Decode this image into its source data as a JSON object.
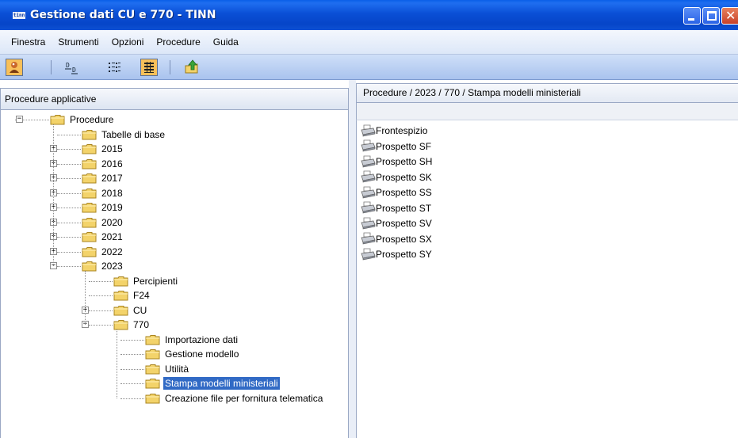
{
  "window": {
    "title": "Gestione dati CU e 770 - TINN",
    "logo_text": "tinn",
    "close_glyph": "✕"
  },
  "menu": [
    "Finestra",
    "Strumenti",
    "Opzioni",
    "Procedure",
    "Guida"
  ],
  "toolbar": {
    "buttons": [
      "user-icon",
      "sort-icon",
      "list-view-icon",
      "details-view-icon",
      "export-icon"
    ]
  },
  "left_panel": {
    "title": "Procedure applicative",
    "tree": {
      "root": "Procedure",
      "tabelle": "Tabelle di base",
      "years": [
        "2015",
        "2016",
        "2017",
        "2018",
        "2019",
        "2020",
        "2021",
        "2022"
      ],
      "year_2023": "2023",
      "y2023_children": [
        "Percipienti",
        "F24",
        "CU",
        "770"
      ],
      "y770_children": [
        "Importazione dati",
        "Gestione modello",
        "Utilità",
        "Stampa modelli ministeriali",
        "Creazione file per fornitura telematica"
      ],
      "selected": "Stampa modelli ministeriali"
    }
  },
  "right_panel": {
    "breadcrumb": "Procedure / 2023 / 770 / Stampa modelli ministeriali",
    "items": [
      "Frontespizio",
      "Prospetto SF",
      "Prospetto SH",
      "Prospetto SK",
      "Prospetto SS",
      "Prospetto ST",
      "Prospetto SV",
      "Prospetto SX",
      "Prospetto SY"
    ]
  },
  "colors": {
    "titlebar": "#0a4fd6",
    "selection": "#316ac5",
    "folder": "#f3d36a"
  }
}
